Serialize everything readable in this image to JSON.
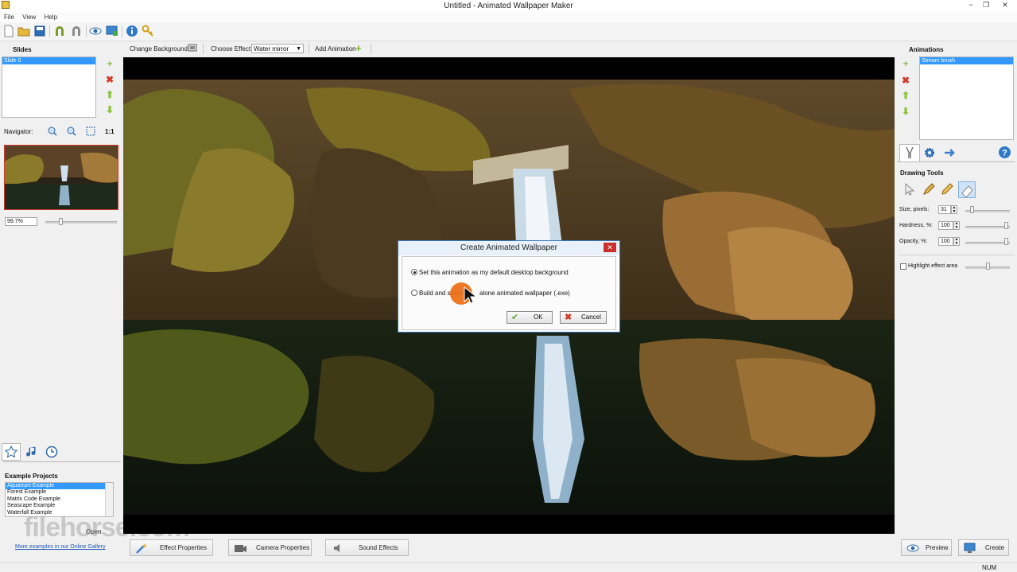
{
  "window": {
    "title": "Untitled - Animated Wallpaper Maker",
    "minimize": "−",
    "restore": "❐",
    "close": "✕"
  },
  "menu": [
    "File",
    "View",
    "Help"
  ],
  "actionbar": {
    "change_background": "Change Background",
    "choose_effect_label": "Choose Effect:",
    "effect_value": "Water mirror",
    "add_animation": "Add Animation"
  },
  "slides": {
    "title": "Slides",
    "items": [
      "Slide 0"
    ]
  },
  "navigator": {
    "label": "Navigator:",
    "one_to_one": "1:1",
    "zoom": "99.7%"
  },
  "examples": {
    "title": "Example Projects",
    "items": [
      "Aquarium Example",
      "Forest Example",
      "Matrix Code Example",
      "Seascape Example",
      "Waterfall Example"
    ],
    "open_button": "Open",
    "gallery_link": "More examples in our Online Gallery"
  },
  "animations": {
    "title": "Animations",
    "items": [
      "Stream brush"
    ]
  },
  "drawing_tools": {
    "title": "Drawing Tools",
    "size_label": "Size, pixels:",
    "size_value": "31",
    "hardness_label": "Hardness, %:",
    "hardness_value": "100",
    "opacity_label": "Opacity, %:",
    "opacity_value": "100",
    "highlight_label": "Highlight effect area"
  },
  "dialog": {
    "title": "Create Animated Wallpaper",
    "option1": "Set this animation as my default desktop background",
    "option2_left": "Build and save a",
    "option2_right": "alone animated wallpaper (.exe)",
    "ok": "OK",
    "cancel": "Cancel"
  },
  "bottom_bar": {
    "effect_properties": "Effect Properties",
    "camera_properties": "Camera Properties",
    "sound_effects": "Sound Effects",
    "preview": "Preview",
    "create": "Create"
  },
  "status": {
    "num": "NUM"
  },
  "watermark": "filehorse.com"
}
